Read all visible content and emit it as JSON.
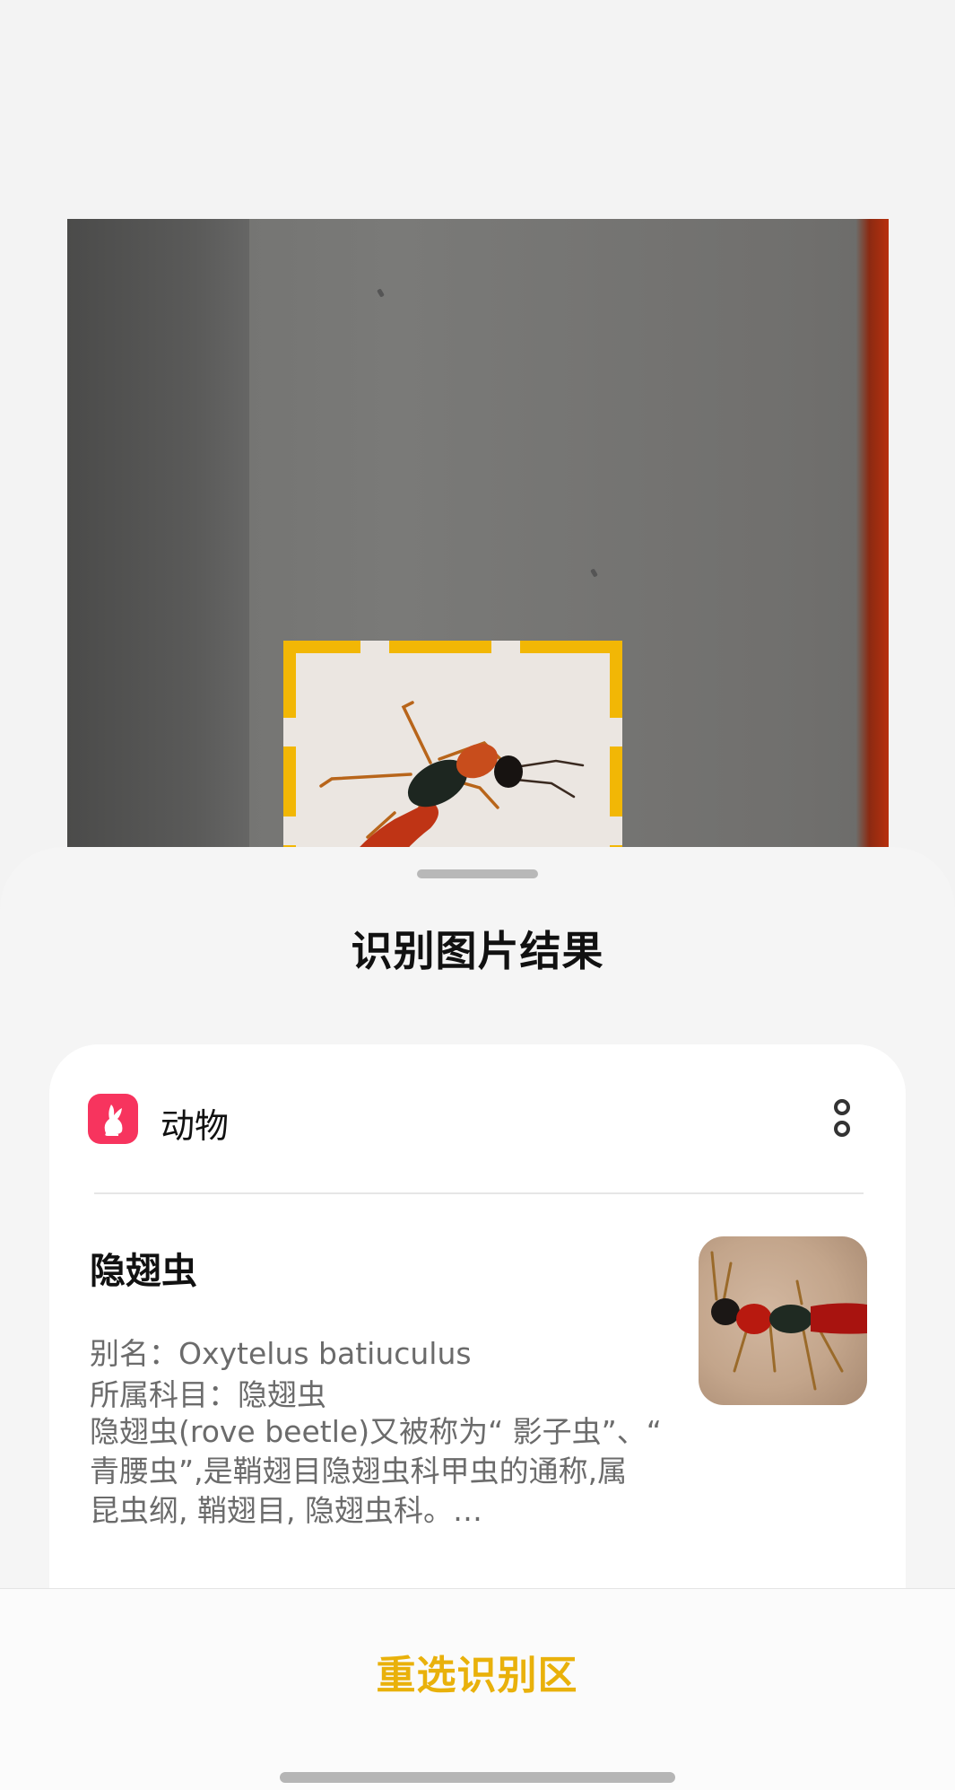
{
  "sheet": {
    "title": "识别图片结果"
  },
  "result": {
    "category": {
      "label": "动物",
      "icon": "rabbit-icon",
      "icon_color": "#f7345e"
    },
    "more_icon": "more-vertical-icon",
    "name": "隐翅虫",
    "alias_label": "别名：",
    "alias_value": "Oxytelus batiuculus",
    "family_label": "所属科目：",
    "family_value": "隐翅虫",
    "description": "隐翅虫(rove beetle)又被称为“ 影子虫”、“ 青腰虫”,是鞘翅目隐翅虫科甲虫的通称,属 昆虫纲, 鞘翅目, 隐翅虫科。…"
  },
  "actions": {
    "reselect_label": "重选识别区"
  },
  "colors": {
    "accent": "#e9b10b",
    "selection_frame": "#f2b705"
  }
}
